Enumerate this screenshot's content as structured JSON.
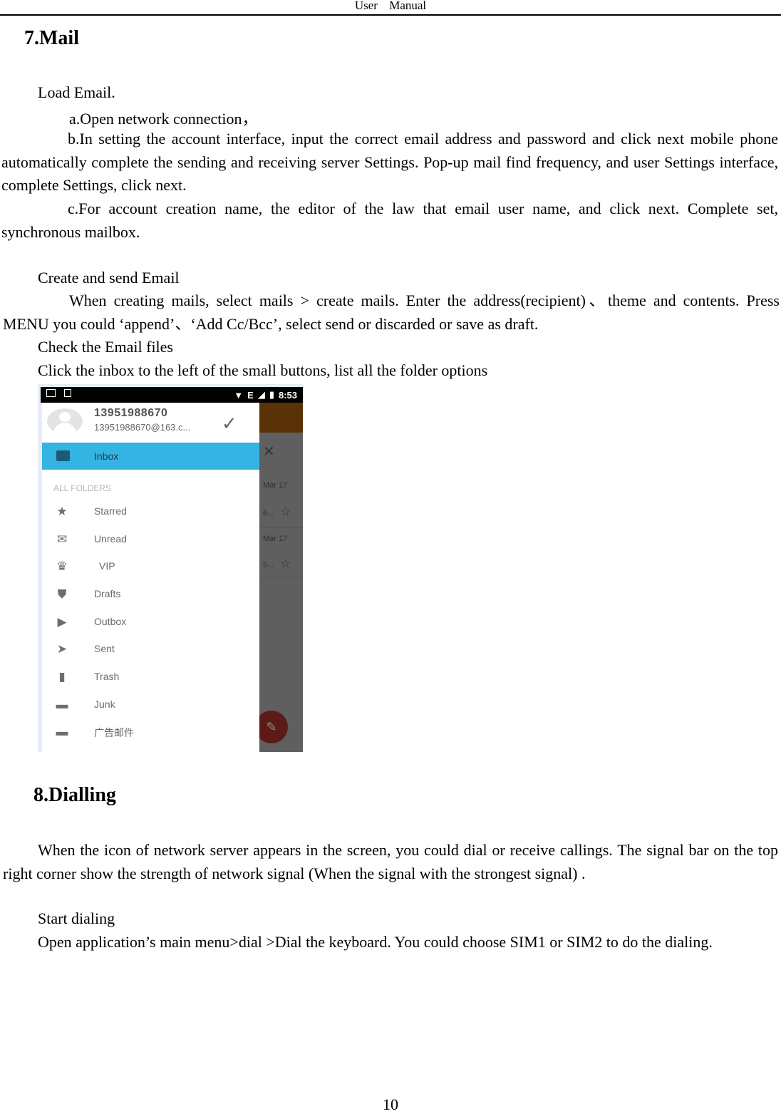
{
  "header": {
    "left_word": "User",
    "right_word": "Manual"
  },
  "sections": {
    "mail": {
      "title": "7.Mail",
      "load_heading": "Load Email.",
      "step_a": "a.Open network connection，",
      "step_b": "b.In setting the account interface, input the correct email address and password and click next mobile phone automatically complete the sending and receiving server Settings. Pop-up mail find frequency, and user Settings interface, complete Settings, click next.",
      "step_c": "c.For account creation name, the editor of the law that email user name, and click next. Complete set, synchronous mailbox.",
      "create_heading": "Create and send Email",
      "create_text": "When creating mails, select mails > create mails. Enter the address(recipient)、theme and contents. Press MENU you could ‘append’、‘Add Cc/Bcc’,   select send or discarded or save as draft.",
      "check_heading": "Check the Email files",
      "check_text": "Click the inbox to the left of the small buttons, list all the folder options"
    },
    "dialling": {
      "title": "8.Dialling",
      "intro": "When the icon of network server appears in the screen, you could dial or receive callings. The signal bar on the top right corner show the strength of network signal (When the signal with the strongest signal) .",
      "start_heading": "Start dialing",
      "start_text": "Open application’s main menu>dial >Dial the keyboard. You could choose SIM1 or SIM2 to do the dialing."
    }
  },
  "phone": {
    "status": {
      "network": "E",
      "time": "8:53"
    },
    "account": {
      "name": "13951988670",
      "email": "13951988670@163.c..."
    },
    "selected_folder": "Inbox",
    "section_label": "ALL FOLDERS",
    "folders": [
      {
        "label": "Starred",
        "icon": "star-icon",
        "glyph": "★"
      },
      {
        "label": "Unread",
        "icon": "envelope-icon",
        "glyph": "✉"
      },
      {
        "label": "VIP",
        "icon": "crown-icon",
        "glyph": "♛"
      },
      {
        "label": "Drafts",
        "icon": "drafts-icon",
        "glyph": "⛊"
      },
      {
        "label": "Outbox",
        "icon": "outbox-icon",
        "glyph": "▶"
      },
      {
        "label": "Sent",
        "icon": "send-icon",
        "glyph": "➤"
      },
      {
        "label": "Trash",
        "icon": "trash-icon",
        "glyph": "▮"
      },
      {
        "label": "Junk",
        "icon": "folder-icon",
        "glyph": "▬"
      },
      {
        "label": "广告邮件",
        "icon": "folder-icon",
        "glyph": "▬"
      }
    ],
    "background_list": [
      {
        "date": "Mar 17",
        "snippet": "6..."
      },
      {
        "date": "Mar 17",
        "snippet": "5..."
      }
    ]
  },
  "page_number": "10"
}
